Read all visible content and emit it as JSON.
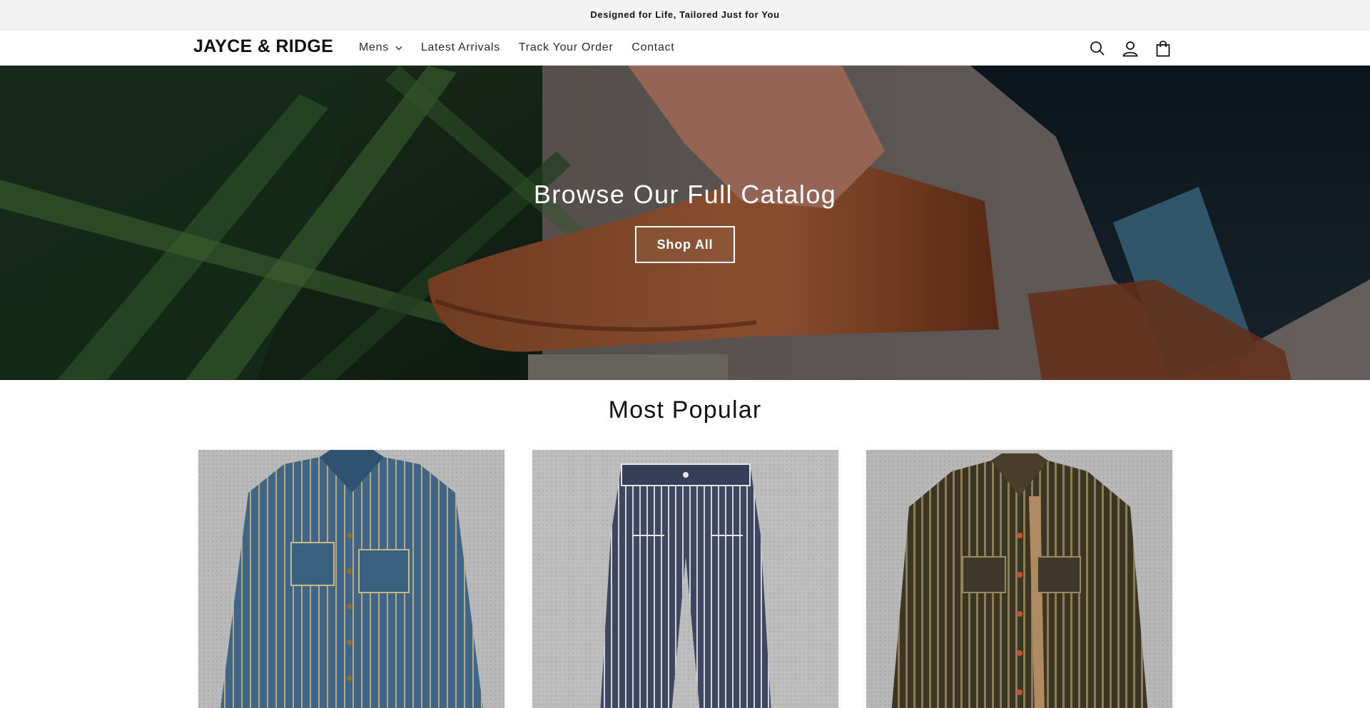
{
  "announcement": {
    "text": "Designed for Life, Tailored Just for You"
  },
  "header": {
    "logo": "JAYCE & RIDGE",
    "nav": [
      {
        "label": "Mens",
        "has_dropdown": true,
        "icon": "chevron-down-icon"
      },
      {
        "label": "Latest Arrivals"
      },
      {
        "label": "Track Your Order"
      },
      {
        "label": "Contact"
      }
    ],
    "icons": [
      "search-icon",
      "account-icon",
      "cart-icon"
    ]
  },
  "hero": {
    "title": "Browse Our Full Catalog",
    "button_label": "Shop All"
  },
  "most_popular": {
    "title": "Most Popular",
    "products": [
      {
        "image": "blue-striped-denim-shirt"
      },
      {
        "image": "striped-work-pants"
      },
      {
        "image": "brown-striped-shirt"
      }
    ]
  },
  "colors": {
    "announcement_bg": "#f3f3f3",
    "text": "#121212",
    "button_border": "#ffffff"
  }
}
